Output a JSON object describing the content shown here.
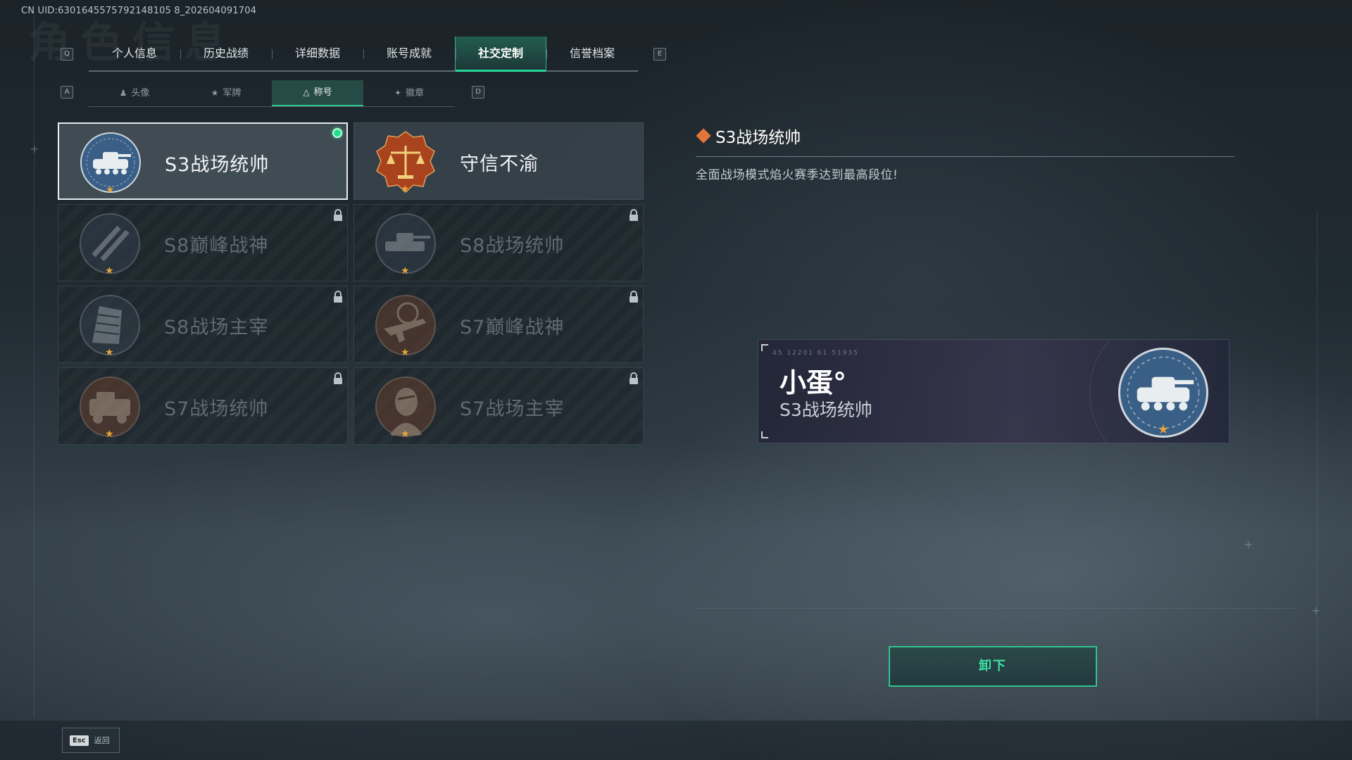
{
  "uid": "CN UID:6301645575792148105 8_202604091704",
  "background_title": "角色信息",
  "top_tabs": {
    "left_key": "Q",
    "right_key": "E",
    "items": [
      {
        "label": "个人信息"
      },
      {
        "label": "历史战绩"
      },
      {
        "label": "详细数据"
      },
      {
        "label": "账号成就"
      },
      {
        "label": "社交定制",
        "active": true
      },
      {
        "label": "信誉档案"
      }
    ]
  },
  "sub_tabs": {
    "left_key": "A",
    "right_key": "D",
    "items": [
      {
        "label": "头像",
        "icon": "person-icon"
      },
      {
        "label": "军牌",
        "icon": "dogtag-icon"
      },
      {
        "label": "称号",
        "icon": "title-icon",
        "active": true
      },
      {
        "label": "徽章",
        "icon": "badge-icon"
      }
    ]
  },
  "titles": [
    {
      "name": "S3战场统帅",
      "state": "selected",
      "emblem": "tank-emblem-icon",
      "color": "#3a5f86"
    },
    {
      "name": "守信不渝",
      "state": "unlocked",
      "emblem": "scales-emblem-icon",
      "color": "#a8431e"
    },
    {
      "name": "S8巅峰战神",
      "state": "locked",
      "emblem": "slash-emblem-icon",
      "color": "#2d3f55"
    },
    {
      "name": "S8战场统帅",
      "state": "locked",
      "emblem": "tank-emblem-icon",
      "color": "#2d3f55"
    },
    {
      "name": "S8战场主宰",
      "state": "locked",
      "emblem": "building-emblem-icon",
      "color": "#2d3f55"
    },
    {
      "name": "S7巅峰战神",
      "state": "locked",
      "emblem": "rifle-emblem-icon",
      "color": "#7a3a1c"
    },
    {
      "name": "S7战场统帅",
      "state": "locked",
      "emblem": "vehicle-emblem-icon",
      "color": "#7a3a1c"
    },
    {
      "name": "S7战场主宰",
      "state": "locked",
      "emblem": "soldier-emblem-icon",
      "color": "#7a3a1c"
    }
  ],
  "detail": {
    "title": "S3战场统帅",
    "description": "全面战场模式焰火赛季达到最高段位!"
  },
  "preview": {
    "nickname": "小蛋°",
    "title": "S3战场统帅",
    "numbers": "45 12201 61 51935"
  },
  "action_button": "卸下",
  "bottom": {
    "esc_key": "Esc",
    "back_label": "返回"
  },
  "colors": {
    "accent": "#2fc48f",
    "active_dot": "#1fe08f",
    "star": "#e3a63a",
    "diamond": "#e0763a"
  }
}
